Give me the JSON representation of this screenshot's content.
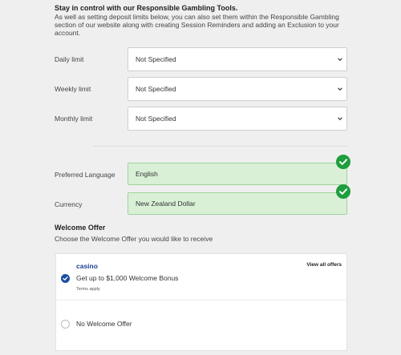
{
  "intro": {
    "title": "Stay in control with our Responsible Gambling Tools.",
    "body": "As well as setting deposit limits below, you can also set them within the Responsible Gambling section of our website along with creating Session Reminders and adding an Exclusion to your account."
  },
  "limits": [
    {
      "label": "Daily limit",
      "value": "Not Specified"
    },
    {
      "label": "Weekly limit",
      "value": "Not Specified"
    },
    {
      "label": "Monthly limit",
      "value": "Not Specified"
    }
  ],
  "preferences": [
    {
      "label": "Preferred Language",
      "value": "English"
    },
    {
      "label": "Currency",
      "value": "New Zealand Dollar"
    }
  ],
  "welcome": {
    "title": "Welcome Offer",
    "subtitle": "Choose the Welcome Offer you would like to receive",
    "view_all": "View all offers",
    "offers": [
      {
        "category": "casino",
        "text": "Get up to $1,000 Welcome Bonus",
        "terms": "Terms apply",
        "selected": true
      },
      {
        "text": "No Welcome Offer",
        "selected": false
      }
    ]
  },
  "colors": {
    "success_green": "#1e9e3c",
    "valid_field_bg": "#d9f0d7",
    "selected_check_blue": "#1a4fa3",
    "brand_blue": "#1a3f8f"
  },
  "icons": {
    "select_chevron": "chevron-down-icon",
    "valid": "checkmark-circle-icon",
    "selected": "checkmark-circle-icon"
  }
}
